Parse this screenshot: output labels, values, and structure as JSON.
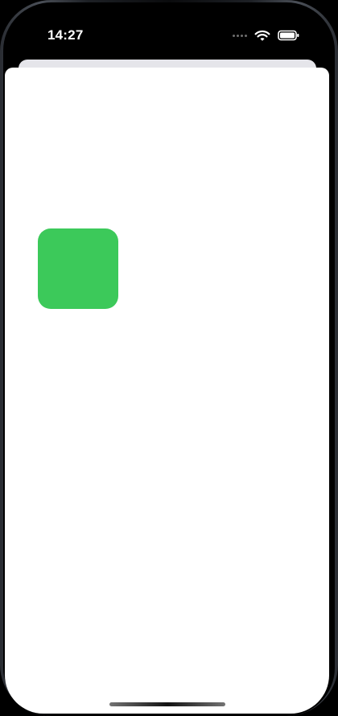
{
  "status_bar": {
    "time": "14:27",
    "signal_icon": "cellular-signal-dots",
    "wifi_icon": "wifi-icon",
    "battery_icon": "battery-icon"
  },
  "colors": {
    "background": "#000000",
    "sheet": "#ffffff",
    "card_back": "#e5e5ea",
    "green_square": "#3cc95a"
  },
  "content": {
    "square_color_name": "green"
  }
}
